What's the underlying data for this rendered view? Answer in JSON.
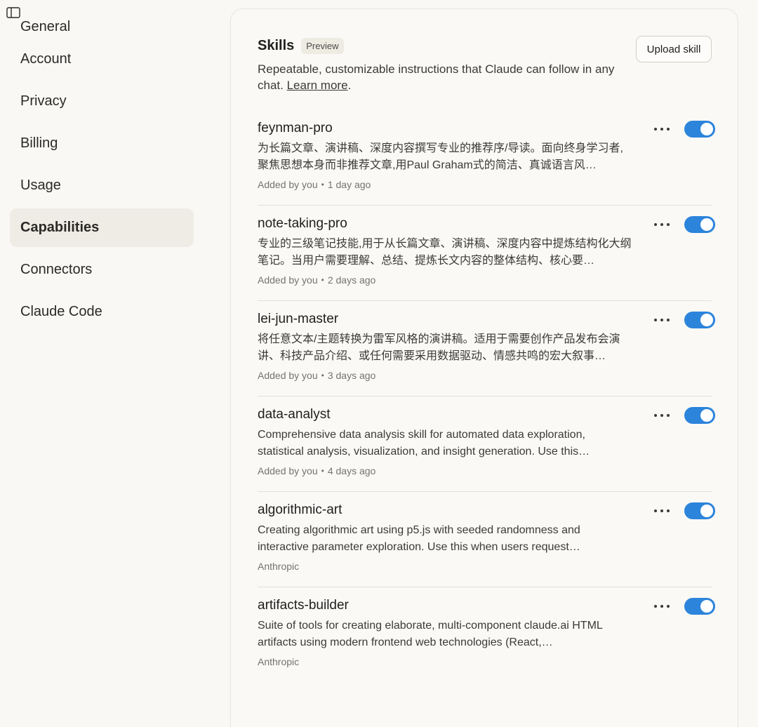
{
  "sidebar": {
    "items": [
      {
        "label": "General",
        "active": false
      },
      {
        "label": "Account",
        "active": false
      },
      {
        "label": "Privacy",
        "active": false
      },
      {
        "label": "Billing",
        "active": false
      },
      {
        "label": "Usage",
        "active": false
      },
      {
        "label": "Capabilities",
        "active": true
      },
      {
        "label": "Connectors",
        "active": false
      },
      {
        "label": "Claude Code",
        "active": false
      }
    ]
  },
  "skills_section": {
    "title": "Skills",
    "badge": "Preview",
    "upload_label": "Upload skill",
    "description_text": "Repeatable, customizable instructions that Claude can follow in any chat. ",
    "learn_more": "Learn more",
    "description_end": ".",
    "skills": [
      {
        "name": "feynman-pro",
        "description": "为长篇文章、演讲稿、深度内容撰写专业的推荐序/导读。面向终身学习者,聚焦思想本身而非推荐文章,用Paul Graham式的简洁、真诚语言风…",
        "added_by": "Added by you",
        "time": "1 day ago",
        "enabled": true
      },
      {
        "name": "note-taking-pro",
        "description": "专业的三级笔记技能,用于从长篇文章、演讲稿、深度内容中提炼结构化大纲笔记。当用户需要理解、总结、提炼长文内容的整体结构、核心要…",
        "added_by": "Added by you",
        "time": "2 days ago",
        "enabled": true
      },
      {
        "name": "lei-jun-master",
        "description": "将任意文本/主题转换为雷军风格的演讲稿。适用于需要创作产品发布会演讲、科技产品介绍、或任何需要采用数据驱动、情感共鸣的宏大叙事…",
        "added_by": "Added by you",
        "time": "3 days ago",
        "enabled": true
      },
      {
        "name": "data-analyst",
        "description": "Comprehensive data analysis skill for automated data exploration, statistical analysis, visualization, and insight generation. Use this…",
        "added_by": "Added by you",
        "time": "4 days ago",
        "enabled": true
      },
      {
        "name": "algorithmic-art",
        "description": "Creating algorithmic art using p5.js with seeded randomness and interactive parameter exploration. Use this when users request…",
        "added_by": "Anthropic",
        "time": "",
        "enabled": true
      },
      {
        "name": "artifacts-builder",
        "description": "Suite of tools for creating elaborate, multi-component claude.ai HTML artifacts using modern frontend web technologies (React,…",
        "added_by": "Anthropic",
        "time": "",
        "enabled": true
      }
    ]
  },
  "colors": {
    "toggle_on": "#2c84db",
    "active_nav_bg": "#efece5",
    "page_bg": "#f9f8f5"
  }
}
